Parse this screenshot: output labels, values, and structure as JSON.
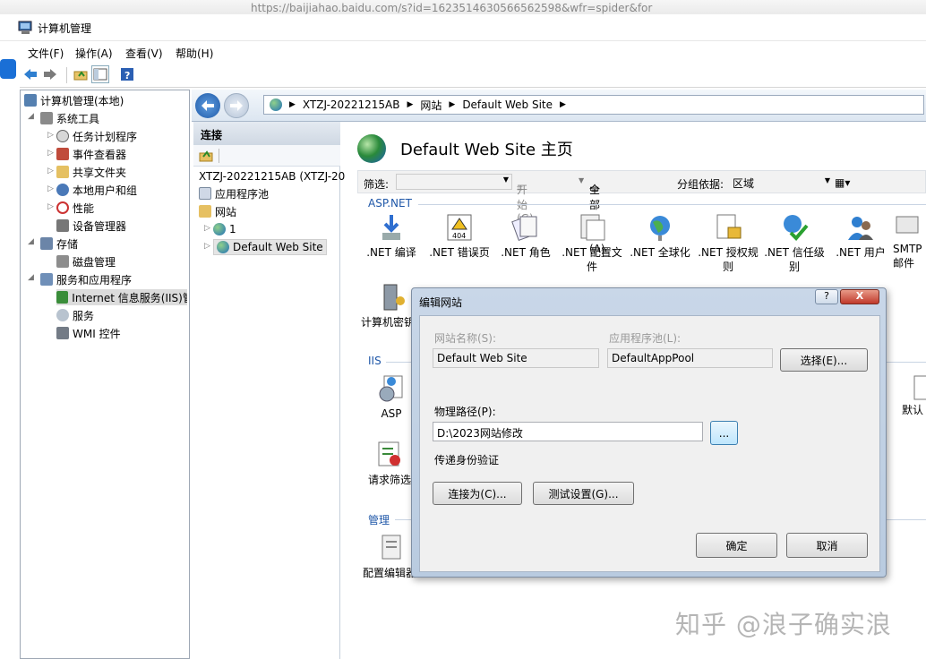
{
  "window": {
    "title": "计算机管理"
  },
  "menu": [
    "文件(F)",
    "操作(A)",
    "查看(V)",
    "帮助(H)"
  ],
  "tree": {
    "root": "计算机管理(本地)",
    "system_tools": "系统工具",
    "task_scheduler": "任务计划程序",
    "event_viewer": "事件查看器",
    "shared_folders": "共享文件夹",
    "local_users": "本地用户和组",
    "performance": "性能",
    "device_manager": "设备管理器",
    "storage": "存储",
    "disk_management": "磁盘管理",
    "services_apps": "服务和应用程序",
    "iis": "Internet 信息服务(IIS)管",
    "services": "服务",
    "wmi": "WMI 控件"
  },
  "address": {
    "server": "XTZJ-20221215AB",
    "sites": "网站",
    "site": "Default Web Site"
  },
  "connections": {
    "header": "连接",
    "server": "XTZJ-20221215AB (XTZJ-20",
    "app_pools": "应用程序池",
    "sites": "网站",
    "site1": "1",
    "default_site": "Default Web Site"
  },
  "home": {
    "title": "Default Web Site 主页"
  },
  "filter": {
    "label": "筛选:",
    "start": "开始(G)",
    "show_all": "全部显示(A)",
    "group_by": "分组依据:",
    "group_value": "区域"
  },
  "groups": {
    "aspnet": "ASP.NET",
    "iis": "IIS",
    "manage": "管理"
  },
  "features": [
    ".NET 编译",
    ".NET 错误页",
    ".NET 角色",
    ".NET 配置文件",
    ".NET 全球化",
    ".NET 授权规则",
    ".NET 信任级别",
    ".NET 用户",
    "SMTP 邮件"
  ],
  "features_row2": {
    "machine_key": "计算机密钥",
    "asp": "ASP",
    "request_filter": "请求筛选",
    "default_doc": "默认",
    "config_editor": "配置编辑器"
  },
  "dialog": {
    "title": "编辑网站",
    "site_name_label": "网站名称(S):",
    "site_name": "Default Web Site",
    "app_pool_label": "应用程序池(L):",
    "app_pool": "DefaultAppPool",
    "select_btn": "选择(E)...",
    "path_label": "物理路径(P):",
    "path": "D:\\2023网站修改",
    "browse_btn": "...",
    "pass_auth": "传递身份验证",
    "connect_as": "连接为(C)...",
    "test_settings": "测试设置(G)...",
    "ok": "确定",
    "cancel": "取消",
    "help": "?",
    "close": "X"
  },
  "watermark": "知乎 @浪子确实浪",
  "browser_strip": "https://baijiahao.baidu.com/s?id=1623514630566562598&wfr=spider&for"
}
